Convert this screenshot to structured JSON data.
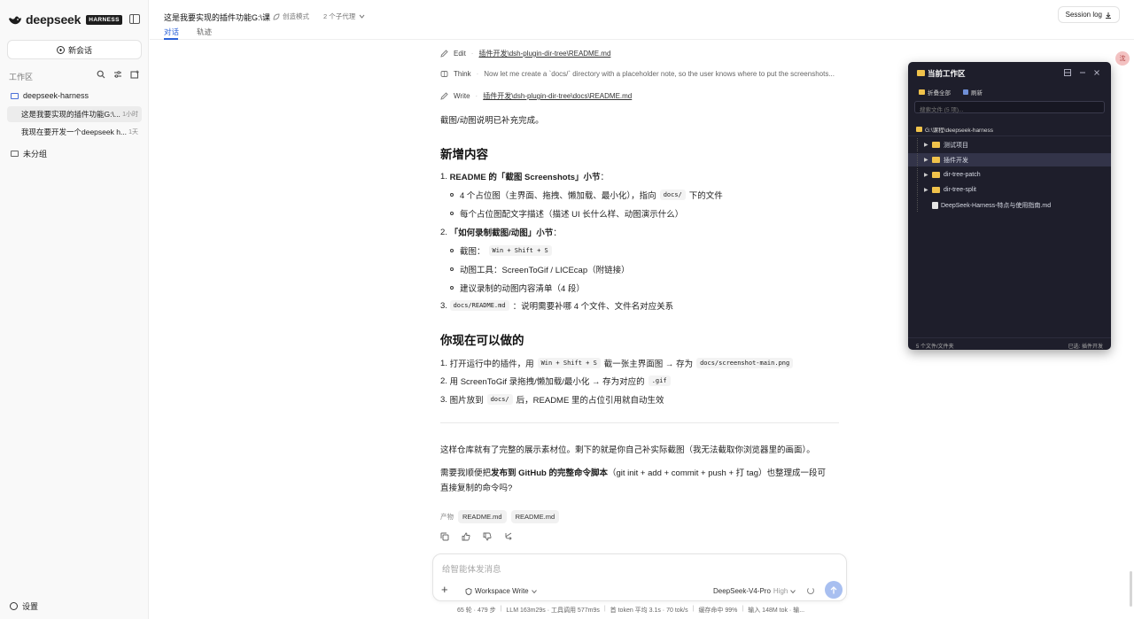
{
  "sidebar": {
    "brand": "deepseek",
    "brand_badge": "HARNESS",
    "new_chat": "新会话",
    "workspace_label": "工作区",
    "groups": [
      {
        "name": "deepseek-harness",
        "sessions": [
          {
            "title": "这是我要实现的插件功能G:\\...",
            "time": "1小时"
          },
          {
            "title": "我现在要开发一个deepseek h...",
            "time": "1天"
          }
        ]
      },
      {
        "name": "未分组"
      }
    ],
    "settings": "设置"
  },
  "header": {
    "title": "这是我要实现的插件功能G:\\课",
    "mode": "创造模式",
    "subagents": "2 个子代理",
    "tabs": [
      "对话",
      "轨迹"
    ],
    "session_log": "Session log"
  },
  "tools": [
    {
      "kind": "Edit",
      "target": "插件开发\\dsh-plugin-dir-tree\\README.md"
    },
    {
      "kind": "Think",
      "target": "Now let me create a `docs/` directory with a placeholder note, so the user knows where to put the screenshots..."
    },
    {
      "kind": "Write",
      "target": "插件开发\\dsh-plugin-dir-tree\\docs\\README.md"
    }
  ],
  "message": {
    "intro": "截图/动图说明已补充完成。",
    "h_new": "新增内容",
    "item1_title": "README 的「截图 Screenshots」小节",
    "item1_title_suffix": "：",
    "item1_b1_pre": "4 个占位图（主界面、拖拽、懒加载、最小化），指向",
    "item1_b1_code": "docs/",
    "item1_b1_post": "下的文件",
    "item1_b2": "每个占位图配文字描述（描述 UI 长什么样、动图演示什么）",
    "item2_title": "「如何录制截图/动图」小节",
    "item2_title_suffix": "：",
    "item2_b1_pre": "截图：",
    "item2_b1_code": "Win + Shift + S",
    "item2_b2": "动图工具：ScreenToGif / LICEcap（附链接）",
    "item2_b3": "建议录制的动图内容清单（4 段）",
    "item3_code": "docs/README.md",
    "item3_post": "：说明需要补哪 4 个文件、文件名对应关系",
    "h_now": "你现在可以做的",
    "n1_pre": "打开运行中的插件，用",
    "n1_code": "Win + Shift + S",
    "n1_mid": "截一张主界面图 → 存为",
    "n1_code2": "docs/screenshot-main.png",
    "n2_pre": "用 ScreenToGif 录拖拽/懒加载/最小化 → 存为对应的",
    "n2_code": ".gif",
    "n3_pre": "图片放到",
    "n3_code": "docs/",
    "n3_post": "后，README 里的占位引用就自动生效",
    "close": "这样仓库就有了完整的展示素材位。剩下的就是你自己补实际截图（我无法截取你浏览器里的画面）。",
    "ask_pre": "需要我顺便把",
    "ask_bold": "发布到 GitHub 的完整命令脚本",
    "ask_post": "（git init + add + commit + push + 打 tag）也整理成一段可",
    "ask_line2": "直接复制的命令吗?"
  },
  "artifacts": {
    "label": "产物",
    "items": [
      "README.md",
      "README.md"
    ]
  },
  "composer": {
    "placeholder": "给智能体发消息",
    "permission": "Workspace Write",
    "model": "DeepSeek-V4-Pro",
    "level": "High"
  },
  "status": [
    "65 轮 · 479 步",
    "LLM 163m29s · 工具调用 577m9s",
    "首 token 平均 3.1s · 70 tok/s",
    "缓存命中 99%",
    "输入 148M tok · 输..."
  ],
  "avatar": "沈",
  "panel": {
    "title": "当前工作区",
    "collapse_all": "折叠全部",
    "refresh": "刷新",
    "search_placeholder": "搜索文件 (5 项)...",
    "root": "G:\\课程\\deepseek-harness",
    "nodes": [
      {
        "name": "测试项目",
        "type": "folder",
        "selected": false
      },
      {
        "name": "插件开发",
        "type": "folder",
        "selected": true
      },
      {
        "name": "dir-tree-patch",
        "type": "folder",
        "selected": false
      },
      {
        "name": "dir-tree-split",
        "type": "folder",
        "selected": false
      },
      {
        "name": "DeepSeek-Harness-特点与使用指南.md",
        "type": "file",
        "selected": false
      }
    ],
    "footer_left": "5 个文件/文件夹",
    "footer_right": "已选: 插件开发"
  }
}
